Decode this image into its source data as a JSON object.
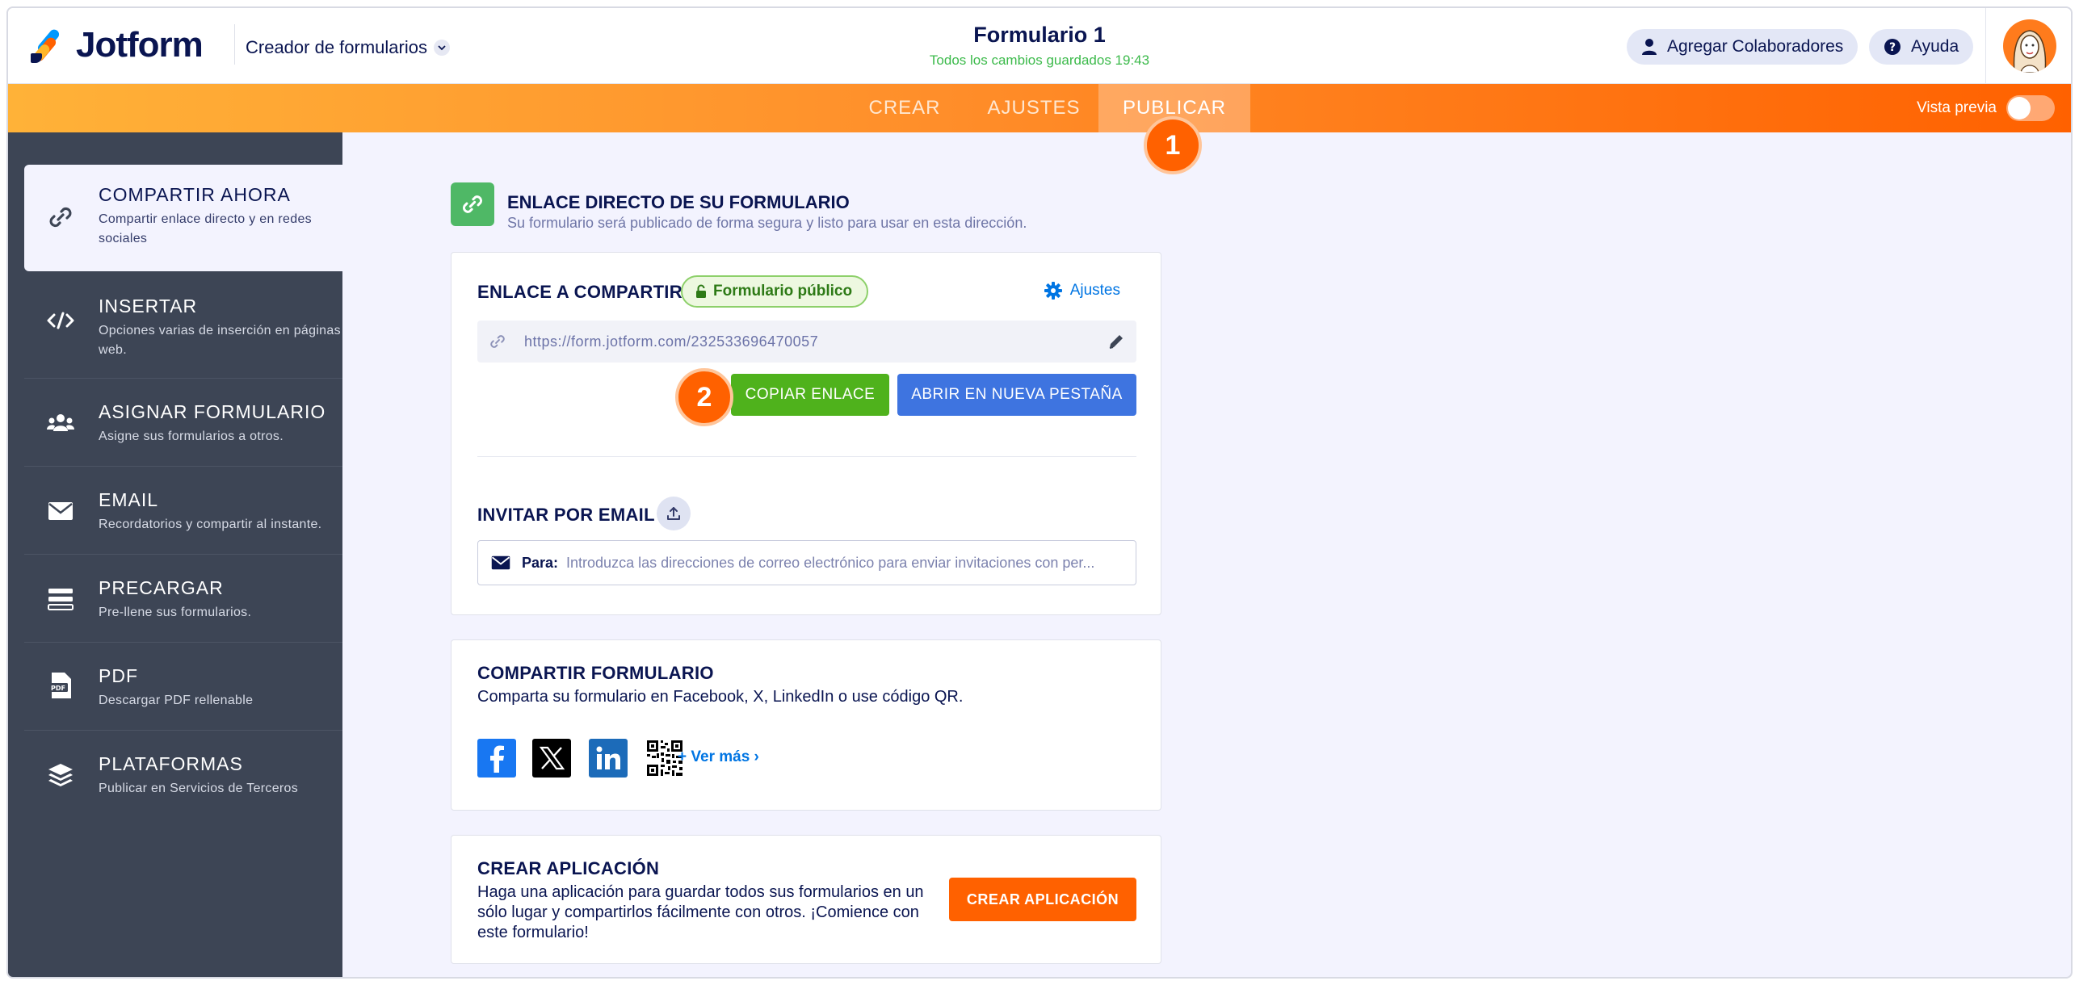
{
  "header": {
    "brand": "Jotform",
    "builder_menu": "Creador de formularios",
    "form_title": "Formulario 1",
    "saved_status": "Todos los cambios guardados 19:43",
    "collaborators_label": "Agregar Colaboradores",
    "help_label": "Ayuda"
  },
  "nav": {
    "tabs": [
      {
        "label": "CREAR",
        "active": false
      },
      {
        "label": "AJUSTES",
        "active": false
      },
      {
        "label": "PUBLICAR",
        "active": true
      }
    ],
    "preview_label": "Vista previa",
    "preview_enabled": false
  },
  "steps": {
    "one": "1",
    "two": "2"
  },
  "sidebar": {
    "items": [
      {
        "title": "COMPARTIR AHORA",
        "desc": "Compartir enlace directo y en redes sociales",
        "icon": "link-icon",
        "active": true
      },
      {
        "title": "INSERTAR",
        "desc": "Opciones varias de inserción en páginas web.",
        "icon": "code-icon",
        "active": false
      },
      {
        "title": "ASIGNAR FORMULARIO",
        "desc": "Asigne sus formularios a otros.",
        "icon": "users-icon",
        "active": false
      },
      {
        "title": "EMAIL",
        "desc": "Recordatorios y compartir al instante.",
        "icon": "envelope-icon",
        "active": false
      },
      {
        "title": "PRECARGAR",
        "desc": "Pre-llene sus formularios.",
        "icon": "prefill-icon",
        "active": false
      },
      {
        "title": "PDF",
        "desc": "Descargar PDF rellenable",
        "icon": "pdf-icon",
        "active": false
      },
      {
        "title": "PLATAFORMAS",
        "desc": "Publicar en Servicios de Terceros",
        "icon": "layers-icon",
        "active": false
      }
    ]
  },
  "direct_link": {
    "title": "ENLACE DIRECTO DE SU FORMULARIO",
    "subtitle": "Su formulario será publicado de forma segura y listo para usar en esta dirección."
  },
  "share_card": {
    "title": "ENLACE A COMPARTIR",
    "public_badge": "Formulario público",
    "settings_label": "Ajustes",
    "url": "https://form.jotform.com/232533696470057",
    "copy_button": "COPIAR ENLACE",
    "open_button": "ABRIR EN NUEVA PESTAÑA",
    "invite_title": "INVITAR POR EMAIL",
    "to_label": "Para:",
    "email_placeholder": "Introduzca las direcciones de correo electrónico para enviar invitaciones con per..."
  },
  "social_card": {
    "title": "COMPARTIR FORMULARIO",
    "description": "Comparta su formulario en Facebook, X, LinkedIn o use código QR.",
    "more_label": "+ Ver más ›"
  },
  "app_card": {
    "title": "CREAR APLICACIÓN",
    "description": "Haga una aplicación para guardar todos sus formularios en un sólo lugar y compartirlos fácilmente con otros. ¡Comience con este formulario!",
    "button": "CREAR APLICACIÓN"
  },
  "colors": {
    "brand_orange": "#ff6100",
    "nav_start": "#ffb238",
    "sidebar_bg": "#3d4555",
    "green_button": "#4fb21c",
    "blue_button": "#3e74e0",
    "link_blue": "#0075e3"
  }
}
